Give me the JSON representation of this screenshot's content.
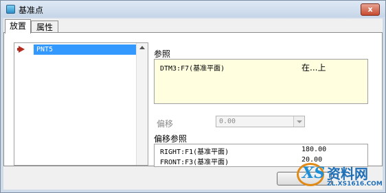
{
  "window": {
    "title": "基准点",
    "close_glyph": "x"
  },
  "tabs": [
    {
      "label": "放置",
      "active": true
    },
    {
      "label": "属性",
      "active": false
    }
  ],
  "list": {
    "items": [
      "PNT5"
    ]
  },
  "references": {
    "label": "参照",
    "items": [
      {
        "name": "DTM3:F7(基准平面)",
        "constraint": "在...上"
      }
    ]
  },
  "offset": {
    "label": "偏移",
    "value": "0.00",
    "enabled": false
  },
  "offset_references": {
    "label": "偏移参照",
    "rows": [
      {
        "name": "RIGHT:F1(基准平面)",
        "value": "180.00"
      },
      {
        "name": "FRONT:F3(基准平面)",
        "value": "20.00"
      }
    ]
  },
  "watermark": {
    "text": "资料网",
    "url": "ZL.XS1616.COM"
  },
  "colors": {
    "selection": "#3399ff",
    "reference_bg": "#ffffe0",
    "arrow": "#b52b1e"
  }
}
